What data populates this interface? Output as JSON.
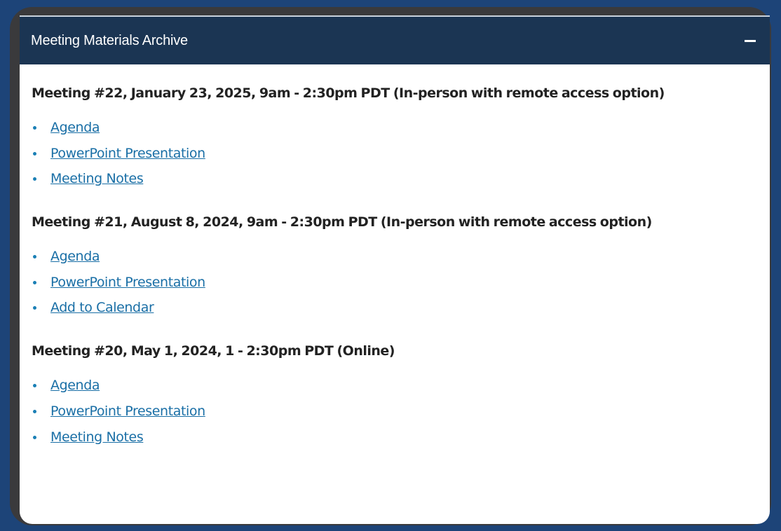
{
  "panel": {
    "title": "Meeting Materials Archive",
    "collapse_icon": "minus-icon"
  },
  "meetings": [
    {
      "heading": "Meeting #22, January 23, 2025, 9am - 2:30pm PDT (In-person with remote access option)",
      "links": [
        "Agenda",
        "PowerPoint Presentation",
        "Meeting Notes"
      ]
    },
    {
      "heading": "Meeting #21, August 8, 2024, 9am - 2:30pm PDT (In-person with remote access option)",
      "links": [
        "Agenda",
        "PowerPoint Presentation",
        "Add to Calendar"
      ]
    },
    {
      "heading": "Meeting #20, May 1, 2024, 1 - 2:30pm PDT (Online)",
      "links": [
        "Agenda",
        "PowerPoint Presentation",
        "Meeting Notes"
      ]
    }
  ],
  "colors": {
    "page_background": "#1d4478",
    "header_background": "#1b3553",
    "link": "#1a6fa6",
    "bullet": "#1a7fb5"
  }
}
